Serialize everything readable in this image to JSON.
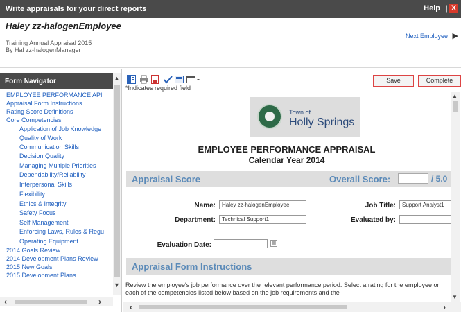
{
  "window": {
    "title": "Write appraisals for your direct reports",
    "help_label": "Help",
    "separator": "|",
    "close_symbol": "X"
  },
  "header": {
    "employee_name": "Haley zz-halogenEmployee",
    "appraisal_name": "Training Annual Appraisal 2015",
    "manager_line": "By Hal zz-halogenManager",
    "next_employee_label": "Next Employee",
    "next_arrow": "▶"
  },
  "form_navigator": {
    "title": "Form Navigator",
    "items": [
      {
        "label": "EMPLOYEE PERFORMANCE API"
      },
      {
        "label": "Appraisal Form Instructions"
      },
      {
        "label": "Rating Score Definitions"
      },
      {
        "label": "Core Competencies"
      },
      {
        "label": "Application of Job Knowledge"
      },
      {
        "label": "Quality of Work"
      },
      {
        "label": "Communication Skills"
      },
      {
        "label": "Decision Quality"
      },
      {
        "label": "Managing Multiple Priorities"
      },
      {
        "label": "Dependability/Reliability"
      },
      {
        "label": "Interpersonal Skills"
      },
      {
        "label": "Flexibility"
      },
      {
        "label": "Ethics & Integrity"
      },
      {
        "label": "Safety Focus"
      },
      {
        "label": "Self Management"
      },
      {
        "label": "Enforcing Laws, Rules & Regu"
      },
      {
        "label": "Operating Equipment"
      },
      {
        "label": "2014 Goals Review"
      },
      {
        "label": "2014 Development Plans Review"
      },
      {
        "label": "2015 New Goals"
      },
      {
        "label": "2015 Development Plans"
      }
    ]
  },
  "toolbar": {
    "save_label": "Save",
    "complete_label": "Complete"
  },
  "form": {
    "required_note": "*Indicates required field",
    "logo_town_of": "Town of",
    "logo_name": "Holly Springs",
    "doc_title": "EMPLOYEE PERFORMANCE APPRAISAL",
    "doc_subtitle": "Calendar Year 2014",
    "appraisal_score_title": "Appraisal Score",
    "overall_score_label": "Overall Score:",
    "overall_score_value": "",
    "overall_score_max": "/ 5.0",
    "name_label": "Name:",
    "name_value": "Haley zz-halogenEmployee",
    "job_title_label": "Job Title:",
    "job_title_value": "Support Analyst1",
    "department_label": "Department:",
    "department_value": "Technical Support1",
    "evaluated_by_label": "Evaluated by:",
    "evaluated_by_value": "",
    "evaluation_date_label": "Evaluation Date:",
    "evaluation_date_value": "",
    "instructions_title": "Appraisal Form Instructions",
    "instructions_text": "Review the employee's job performance over the relevant performance period. Select a rating for the employee on each of the competencies listed below based on the job requirements and the"
  },
  "icons": {
    "toolbar": [
      "form-view-icon",
      "print-icon",
      "pdf-icon",
      "spell-check-icon",
      "calculator-icon",
      "options-dropdown-icon"
    ],
    "calendar": "calendar-icon"
  }
}
